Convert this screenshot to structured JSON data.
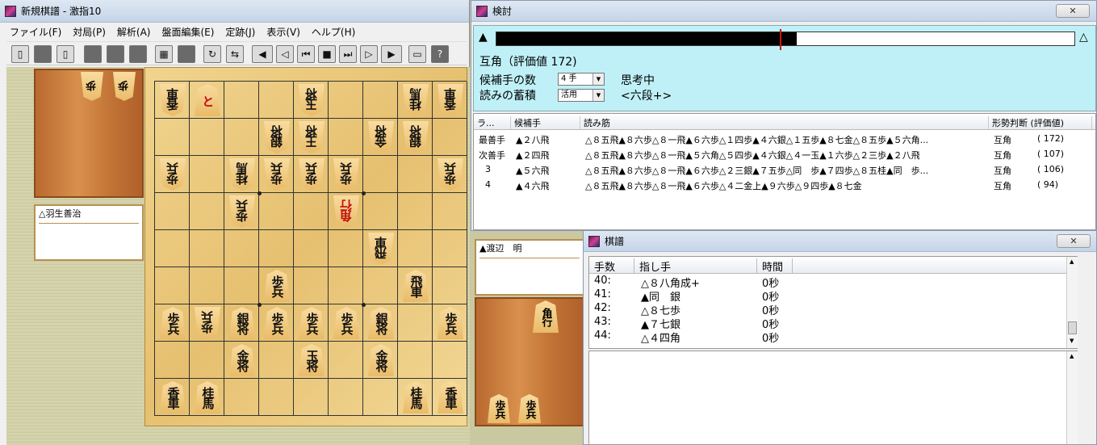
{
  "main_window": {
    "title": "新規棋譜 - 激指10",
    "menu": [
      "ファイル(F)",
      "対局(P)",
      "解析(A)",
      "盤面編集(E)",
      "定跡(J)",
      "表示(V)",
      "ヘルプ(H)"
    ]
  },
  "players": {
    "gote_name": "△羽生善治",
    "sente_name": "▲渡辺　明"
  },
  "hands": {
    "gote": [
      "歩",
      "歩"
    ],
    "sente_upper": [
      "角行"
    ],
    "sente_lower": [
      "歩兵",
      "歩兵"
    ]
  },
  "board": {
    "rows": [
      [
        {
          "p": "香車",
          "o": "g"
        },
        {
          "p": "と",
          "o": "s",
          "red": true
        },
        null,
        null,
        {
          "p": "玉将",
          "o": "g"
        },
        null,
        null,
        {
          "p": "桂馬",
          "o": "g"
        },
        {
          "p": "香車",
          "o": "g"
        }
      ],
      [
        null,
        null,
        null,
        {
          "p": "銀将",
          "o": "g"
        },
        {
          "p": "王将",
          "o": "g"
        },
        null,
        {
          "p": "金将",
          "o": "g"
        },
        {
          "p": "銀将",
          "o": "g"
        },
        null
      ],
      [
        {
          "p": "歩兵",
          "o": "g"
        },
        null,
        {
          "p": "桂馬",
          "o": "g"
        },
        {
          "p": "歩兵",
          "o": "g"
        },
        {
          "p": "歩兵",
          "o": "g"
        },
        {
          "p": "歩兵",
          "o": "g"
        },
        null,
        null,
        {
          "p": "歩兵",
          "o": "g"
        }
      ],
      [
        null,
        null,
        {
          "p": "歩兵",
          "o": "g"
        },
        null,
        null,
        {
          "p": "角行",
          "o": "g",
          "red": true
        },
        null,
        null,
        null
      ],
      [
        null,
        null,
        null,
        null,
        null,
        null,
        {
          "p": "飛車",
          "o": "g"
        },
        null,
        null
      ],
      [
        null,
        null,
        null,
        {
          "p": "歩兵",
          "o": "s"
        },
        null,
        null,
        null,
        {
          "p": "飛車",
          "o": "s"
        },
        null
      ],
      [
        {
          "p": "歩兵",
          "o": "s"
        },
        {
          "p": "歩兵",
          "o": "g"
        },
        {
          "p": "銀将",
          "o": "s"
        },
        {
          "p": "歩兵",
          "o": "s"
        },
        {
          "p": "歩兵",
          "o": "s"
        },
        {
          "p": "歩兵",
          "o": "s"
        },
        {
          "p": "銀将",
          "o": "s"
        },
        null,
        {
          "p": "歩兵",
          "o": "s"
        }
      ],
      [
        null,
        null,
        {
          "p": "金将",
          "o": "s"
        },
        null,
        {
          "p": "玉将",
          "o": "s"
        },
        null,
        {
          "p": "金将",
          "o": "s"
        },
        null,
        null
      ],
      [
        {
          "p": "香車",
          "o": "s"
        },
        {
          "p": "桂馬",
          "o": "s"
        },
        null,
        null,
        null,
        null,
        null,
        {
          "p": "桂馬",
          "o": "s"
        },
        {
          "p": "香車",
          "o": "s"
        }
      ]
    ]
  },
  "analysis": {
    "title": "検討",
    "close_label": "✕",
    "eval_fill": 0.52,
    "eval_mark": 0.49,
    "left_marker": "▲",
    "right_marker": "△",
    "status_line": "互角（評価値 172)",
    "candidates_label": "候補手の数",
    "candidates_value": "4 手",
    "thinking": "思考中",
    "accumulate_label": "読みの蓄積",
    "accumulate_value": "活用",
    "level": "<六段+>",
    "columns": [
      "ラ...",
      "候補手",
      "読み筋",
      "形勢判断 (評価値)"
    ],
    "rows": [
      {
        "rank": "最善手",
        "move": "▲２八飛",
        "line": "△８五飛▲８六歩△８一飛▲６六歩△１四歩▲４六銀△１五歩▲８七金△８五歩▲５六角...",
        "judge": "互角",
        "score": "( 172)"
      },
      {
        "rank": "次善手",
        "move": "▲２四飛",
        "line": "△８五飛▲８六歩△８一飛▲５六角△５四歩▲４六銀△４一玉▲１六歩△２三歩▲２八飛",
        "judge": "互角",
        "score": "( 107)"
      },
      {
        "rank": "3",
        "move": "▲５六飛",
        "line": "△８五飛▲８六歩△８一飛▲６六歩△２三銀▲７五歩△同　歩▲７四歩△８五桂▲同　歩...",
        "judge": "互角",
        "score": "( 106)"
      },
      {
        "rank": "4",
        "move": "▲４六飛",
        "line": "△８五飛▲８六歩△８一飛▲６六歩△４二金上▲９六歩△９四歩▲８七金",
        "judge": "互角",
        "score": "( 94)"
      }
    ]
  },
  "kifu": {
    "title": "棋譜",
    "close_label": "✕",
    "columns": [
      "手数",
      "指し手",
      "時間"
    ],
    "moves": [
      {
        "n": "40:",
        "move": "△８八角成+",
        "time": "0秒"
      },
      {
        "n": "41:",
        "move": "▲同　銀",
        "time": "0秒"
      },
      {
        "n": "42:",
        "move": "△８七歩",
        "time": "0秒"
      },
      {
        "n": "43:",
        "move": "▲７七銀",
        "time": "0秒"
      },
      {
        "n": "44:",
        "move": "△４四角",
        "time": "0秒"
      }
    ]
  }
}
